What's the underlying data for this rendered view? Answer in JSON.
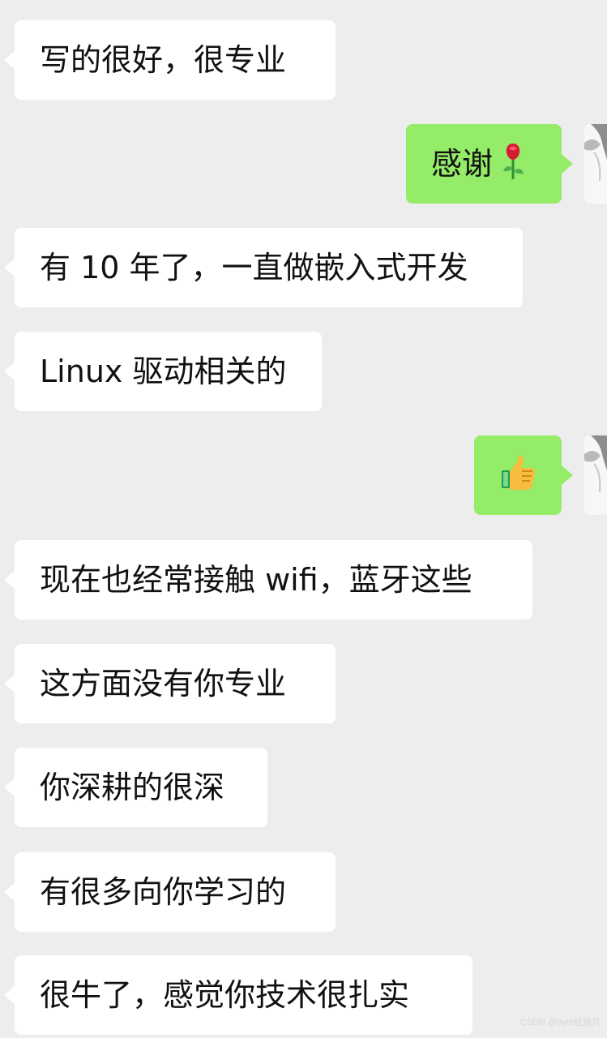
{
  "messages": [
    {
      "side": "left",
      "text": "写的很好，很专业"
    },
    {
      "side": "right",
      "text": "感谢",
      "emoji": "rose"
    },
    {
      "side": "left",
      "text": "有 10 年了，一直做嵌入式开发"
    },
    {
      "side": "left",
      "text": "Linux 驱动相关的"
    },
    {
      "side": "right",
      "text": "",
      "emoji": "thumbs-up"
    },
    {
      "side": "left",
      "text": "现在也经常接触 wifi，蓝牙这些"
    },
    {
      "side": "left",
      "text": "这方面没有你专业"
    },
    {
      "side": "left",
      "text": "你深耕的很深"
    },
    {
      "side": "left",
      "text": "有很多向你学习的"
    },
    {
      "side": "left",
      "text": "很牛了，感觉你技术很扎实"
    }
  ],
  "watermark": "CSDN @byte轻骑兵",
  "colors": {
    "background": "#ededed",
    "incoming_bubble": "#ffffff",
    "outgoing_bubble": "#95ec69",
    "text": "#111111"
  }
}
